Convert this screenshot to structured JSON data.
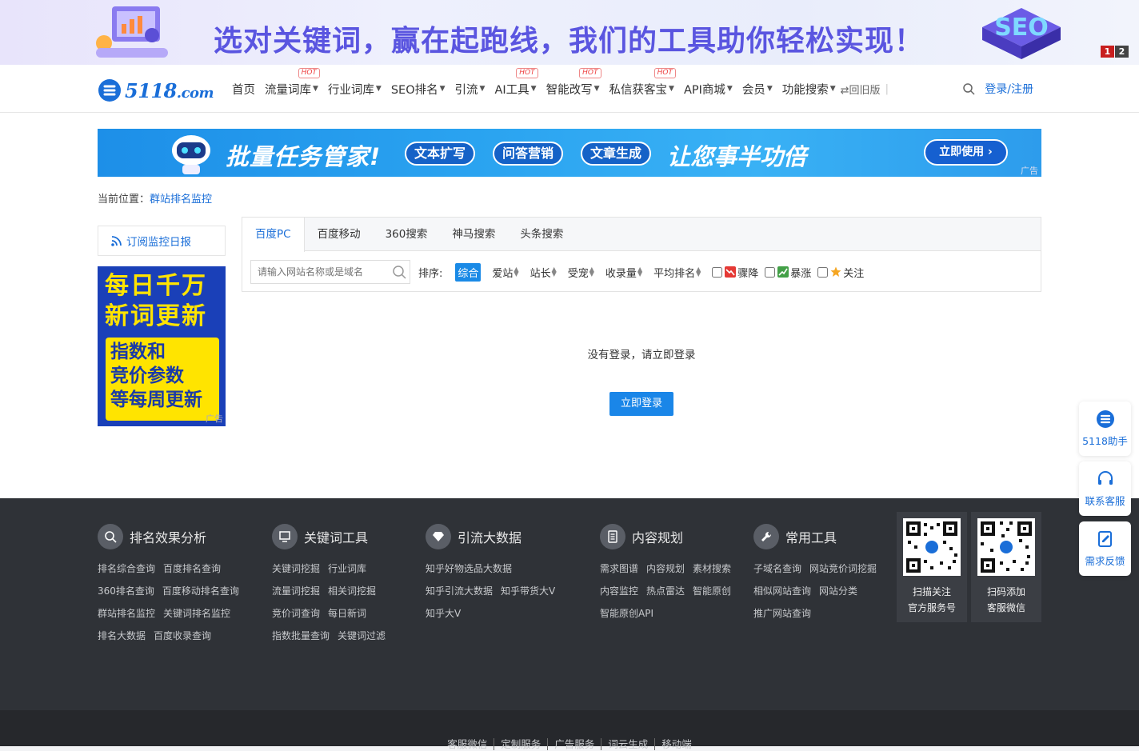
{
  "top_banner": {
    "headline": "选对关键词，赢在起跑线，我们的工具助你轻松实现！",
    "pages": [
      "1",
      "2"
    ]
  },
  "navbar": {
    "logo_text": "5118",
    "logo_suffix": ".com",
    "items": [
      {
        "label": "首页",
        "dropdown": false,
        "hot": false
      },
      {
        "label": "流量词库",
        "dropdown": true,
        "hot": true
      },
      {
        "label": "行业词库",
        "dropdown": true,
        "hot": false
      },
      {
        "label": "SEO排名",
        "dropdown": true,
        "hot": false
      },
      {
        "label": "引流",
        "dropdown": true,
        "hot": false
      },
      {
        "label": "AI工具",
        "dropdown": true,
        "hot": true
      },
      {
        "label": "智能改写",
        "dropdown": true,
        "hot": true
      },
      {
        "label": "私信获客宝",
        "dropdown": true,
        "hot": true
      },
      {
        "label": "API商城",
        "dropdown": true,
        "hot": false
      },
      {
        "label": "会员",
        "dropdown": true,
        "hot": false
      },
      {
        "label": "功能搜索",
        "dropdown": true,
        "hot": false
      }
    ],
    "hot_label": "HOT",
    "old_version": "⇄回旧版",
    "login": "登录/注册"
  },
  "ad_banner": {
    "title": "批量任务管家!",
    "pills": [
      "文本扩写",
      "问答营销",
      "文章生成"
    ],
    "slogan": "让您事半功倍",
    "cta": "立即使用 ›",
    "tag": "广告"
  },
  "breadcrumb": {
    "prefix": "当前位置：",
    "current": "群站排名监控"
  },
  "sidebar": {
    "subscribe": "订阅监控日报",
    "ad_line1": "每日千万",
    "ad_line2": "新词更新",
    "ad_box": [
      "指数和",
      "竞价参数",
      "等每周更新"
    ],
    "ad_tag": "广告"
  },
  "tabs": [
    "百度PC",
    "百度移动",
    "360搜索",
    "神马搜索",
    "头条搜索"
  ],
  "filter": {
    "search_placeholder": "请输入网站名称或是域名",
    "sort_label": "排序:",
    "sort_options": [
      {
        "label": "综合",
        "active": true,
        "arrows": false
      },
      {
        "label": "爱站",
        "active": false,
        "arrows": true
      },
      {
        "label": "站长",
        "active": false,
        "arrows": true
      },
      {
        "label": "受宠",
        "active": false,
        "arrows": true
      },
      {
        "label": "收录量",
        "active": false,
        "arrows": true
      },
      {
        "label": "平均排名",
        "active": false,
        "arrows": true
      }
    ],
    "checks": [
      {
        "label": "骤降",
        "icon": "down-trend-icon",
        "color": "#e53935"
      },
      {
        "label": "暴涨",
        "icon": "up-trend-icon",
        "color": "#43a047"
      },
      {
        "label": "关注",
        "icon": "star-icon",
        "color": "#f5a623"
      }
    ]
  },
  "content": {
    "message": "没有登录，请立即登录",
    "login_button": "立即登录"
  },
  "footer": {
    "columns": [
      {
        "title": "排名效果分析",
        "icon": "analysis-icon",
        "rows": [
          [
            "排名综合查询",
            "百度排名查询"
          ],
          [
            "360排名查询",
            "百度移动排名查询"
          ],
          [
            "群站排名监控",
            "关键词排名监控"
          ],
          [
            "排名大数据",
            "百度收录查询"
          ]
        ]
      },
      {
        "title": "关键词工具",
        "icon": "monitor-icon",
        "rows": [
          [
            "关键词挖掘",
            "行业词库"
          ],
          [
            "流量词挖掘",
            "相关词挖掘"
          ],
          [
            "竞价词查询",
            "每日新词"
          ],
          [
            "指数批量查询",
            "关键词过滤"
          ]
        ]
      },
      {
        "title": "引流大数据",
        "icon": "diamond-icon",
        "rows": [
          [
            "知乎好物选品大数据"
          ],
          [
            "知乎引流大数据",
            "知乎带货大V"
          ],
          [
            "知乎大V"
          ]
        ]
      },
      {
        "title": "内容规划",
        "icon": "document-icon",
        "rows": [
          [
            "需求图谱",
            "内容规划",
            "素材搜索"
          ],
          [
            "内容监控",
            "热点雷达",
            "智能原创"
          ],
          [
            "智能原创API"
          ]
        ]
      },
      {
        "title": "常用工具",
        "icon": "wrench-icon",
        "rows": [
          [
            "子域名查询",
            "网站竞价词挖掘"
          ],
          [
            "相似网站查询",
            "网站分类"
          ],
          [
            "推广网站查询"
          ]
        ]
      }
    ],
    "qr_codes": [
      {
        "caption_line1": "扫描关注",
        "caption_line2": "官方服务号"
      },
      {
        "caption_line1": "扫码添加",
        "caption_line2": "客服微信"
      }
    ],
    "bottom_links": [
      "客服微信",
      "定制服务",
      "广告服务",
      "词云生成",
      "移动端"
    ]
  },
  "float_buttons": [
    {
      "label": "5118助手",
      "icon": "assistant-icon"
    },
    {
      "label": "联系客服",
      "icon": "headset-icon"
    },
    {
      "label": "需求反馈",
      "icon": "feedback-icon"
    }
  ]
}
